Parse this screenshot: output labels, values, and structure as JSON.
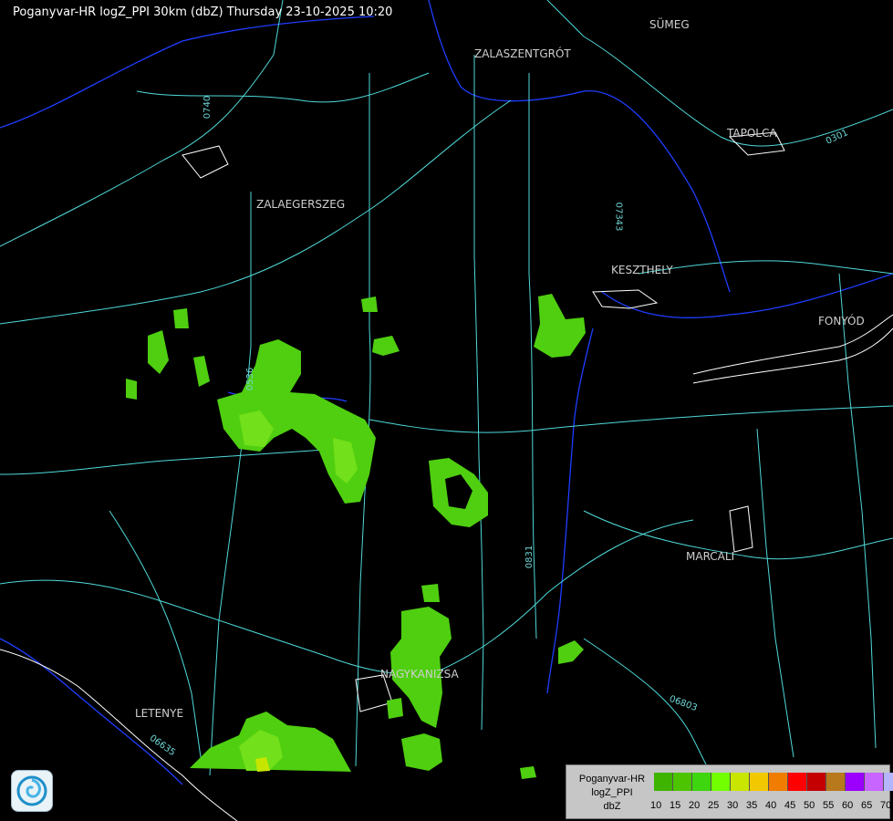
{
  "header": {
    "title": "Poganyvar-HR logZ_PPI 30km (dbZ) Thursday 23-10-2025 10:20"
  },
  "towns": {
    "sumeg": "SÜMEG",
    "zalaszentgrot": "ZALASZENTGRÓT",
    "tapolca": "TAPOLCA",
    "zalaegerszeg": "ZALAEGERSZEG",
    "keszthely": "KESZTHELY",
    "fonyod": "FONYÓD",
    "marcali": "MARCALI",
    "nagykanizsa": "NAGYKANIZSA",
    "letenye": "LETENYE"
  },
  "road_numbers": {
    "r0740": "0740",
    "r07343": "07343",
    "r0536": "0536",
    "r0831": "0831",
    "r06803": "06803",
    "r06635": "06635",
    "r0301": "0301"
  },
  "legend": {
    "name_line1": "Poganyvar-HR",
    "name_line2": "logZ_PPI",
    "name_line3": "dbZ",
    "ticks": [
      "10",
      "15",
      "20",
      "25",
      "30",
      "35",
      "40",
      "45",
      "50",
      "55",
      "60",
      "65",
      "70"
    ],
    "colors": [
      "#3fb400",
      "#4cc400",
      "#3ed60e",
      "#72ff00",
      "#c9e600",
      "#f2c800",
      "#f07d00",
      "#ff0000",
      "#c40000",
      "#b8781c",
      "#9b00ff",
      "#c864ff",
      "#b4b4ff"
    ]
  },
  "colors": {
    "rain_light": "#4fcf10",
    "rain_mid": "#72e01a",
    "rain_core": "#c6e600",
    "road": "#4fd9d9",
    "river": "#1f3dff",
    "border_outline": "#ffffff"
  }
}
